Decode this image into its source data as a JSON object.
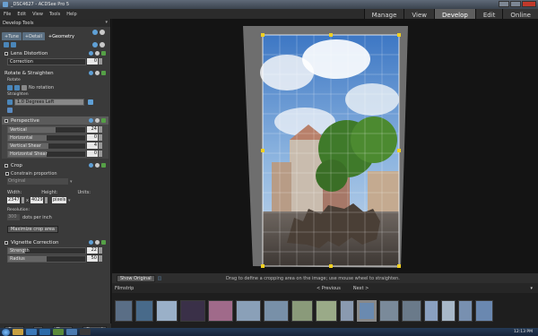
{
  "window": {
    "title": "_DSC4627 - ACDSee Pro 5"
  },
  "menu": [
    "File",
    "Edit",
    "View",
    "Tools",
    "Help"
  ],
  "modes": [
    {
      "label": "Manage",
      "active": false
    },
    {
      "label": "View",
      "active": false
    },
    {
      "label": "Develop",
      "active": true
    },
    {
      "label": "Edit",
      "active": false
    },
    {
      "label": "Online",
      "active": false
    }
  ],
  "panel": {
    "title": "Develop Tools",
    "tabs": [
      "Tune",
      "Detail",
      "Geometry"
    ],
    "lens": {
      "title": "Lens Distortion",
      "correction_label": "Correction",
      "correction_value": "0"
    },
    "rotate": {
      "title": "Rotate & Straighten",
      "rotate_label": "Rotate",
      "no_rotation": "No rotation",
      "straighten_label": "Straighten",
      "straighten_value": "1.0 Degrees Left"
    },
    "perspective": {
      "title": "Perspective",
      "rows": [
        {
          "label": "Vertical",
          "value": "24",
          "fill": 0.62
        },
        {
          "label": "Horizontal",
          "value": "0",
          "fill": 0.5
        },
        {
          "label": "Vertical Shear",
          "value": "4",
          "fill": 0.52
        },
        {
          "label": "Horizontal Shear",
          "value": "0",
          "fill": 0.5
        }
      ]
    },
    "crop": {
      "title": "Crop",
      "constrain": "Constrain proportion",
      "preset": "Original",
      "width_label": "Width:",
      "height_label": "Height:",
      "units_label": "Units:",
      "width": "2347",
      "x": "x",
      "height": "4029",
      "units": "pixels",
      "resolution_label": "Resolution:",
      "resolution": "300",
      "dpi": "dots per inch",
      "maximize": "Maximize crop area"
    },
    "vignette": {
      "title": "Vignette Correction",
      "rows": [
        {
          "label": "Strength",
          "value": "22",
          "fill": 0.22
        },
        {
          "label": "Radius",
          "value": "50",
          "fill": 0.5
        }
      ]
    },
    "buttons": {
      "save": "Save",
      "done": "Done",
      "cancel": "Cancel"
    }
  },
  "status": {
    "show_original": "Show Original",
    "hint": "Drag to define a cropping area on the image; use mouse wheel to straighten."
  },
  "filmstrip": {
    "title": "Filmstrip",
    "prev": "< Previous",
    "next": "Next >",
    "thumbs": [
      {
        "w": 20,
        "c": "#5a6e86"
      },
      {
        "w": 20,
        "c": "#486a8a"
      },
      {
        "w": 24,
        "c": "#9ab0c8"
      },
      {
        "w": 28,
        "c": "#3a3048"
      },
      {
        "w": 28,
        "c": "#a06a8a"
      },
      {
        "w": 28,
        "c": "#8aa0b8"
      },
      {
        "w": 28,
        "c": "#7890a8"
      },
      {
        "w": 24,
        "c": "#8a9a7a"
      },
      {
        "w": 24,
        "c": "#9aaa88"
      },
      {
        "w": 16,
        "c": "#8a9ab0"
      },
      {
        "w": 22,
        "c": "#6a8ab0",
        "sel": true
      },
      {
        "w": 22,
        "c": "#7a8a9a"
      },
      {
        "w": 22,
        "c": "#6a7a8a"
      },
      {
        "w": 16,
        "c": "#8aa0c0"
      },
      {
        "w": 16,
        "c": "#a8b8c8"
      },
      {
        "w": 16,
        "c": "#7890b0"
      },
      {
        "w": 20,
        "c": "#6a88b0"
      }
    ]
  },
  "taskbar": {
    "clock": "12:13 PM",
    "icons": [
      "#c8a040",
      "#3a78b8",
      "#2a6aa8",
      "#5a8a3a",
      "#4a7ab0",
      "#3a3a3a"
    ]
  },
  "colors": {
    "accent": "#4a86b9",
    "crop_handle": "#f0d020"
  }
}
